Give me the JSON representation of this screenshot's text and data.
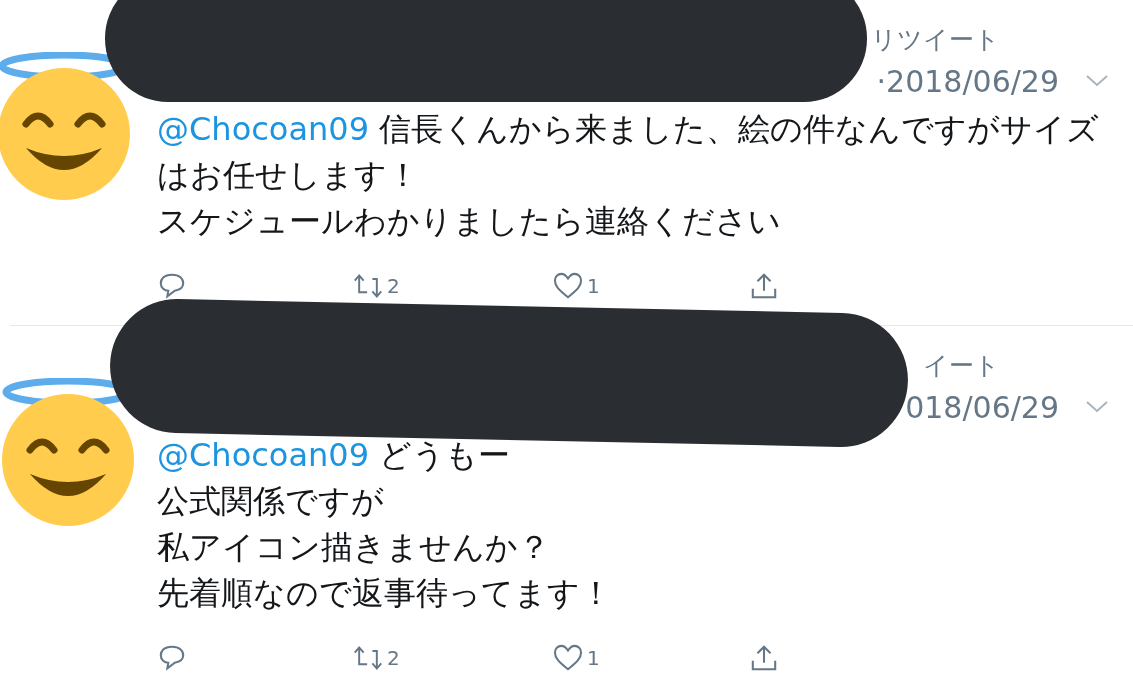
{
  "tweets": [
    {
      "retweet_label": "リツイート",
      "date": "·2018/06/29",
      "mention": "@Chocoan09",
      "lines": [
        "信長くんから来ました、絵の件なんですがサイズはお任せします！",
        "スケジュールわかりましたら連絡ください"
      ],
      "retweets": "2",
      "likes": "1"
    },
    {
      "retweet_label": "イート",
      "date": "018/06/29",
      "mention": "@Chocoan09",
      "lines": [
        "どうもー",
        "公式関係ですが",
        "私アイコン描きませんか？",
        "先着順なので返事待ってます！"
      ],
      "retweets": "2",
      "likes": "1"
    }
  ]
}
